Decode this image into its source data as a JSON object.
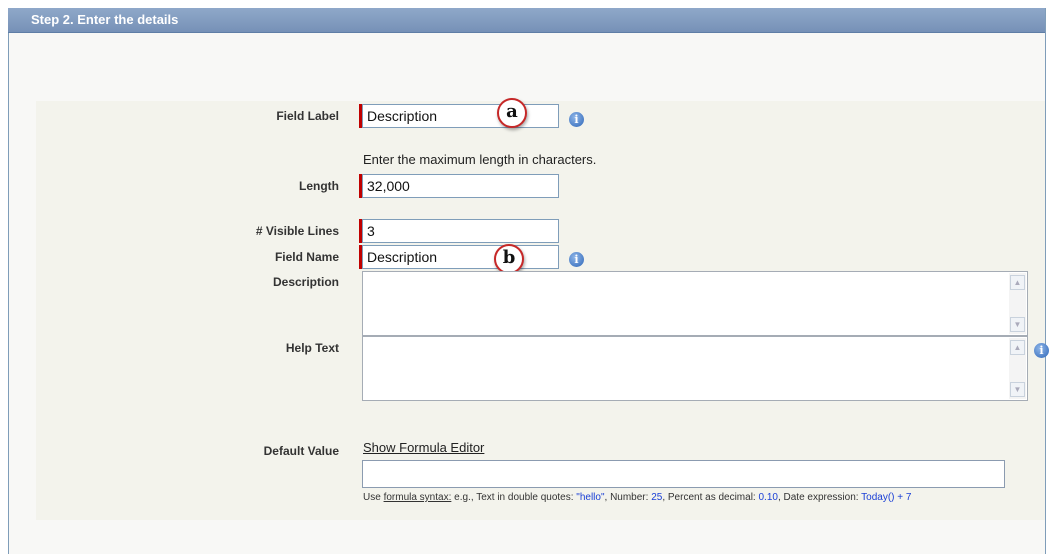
{
  "header": {
    "title": "Step 2. Enter the details"
  },
  "form": {
    "field_label": {
      "label": "Field Label",
      "value": "Description",
      "marker": "a"
    },
    "length_hint": "Enter the maximum length in characters.",
    "length": {
      "label": "Length",
      "value": "32,000"
    },
    "visible_lines": {
      "label": "# Visible Lines",
      "value": "3"
    },
    "field_name": {
      "label": "Field Name",
      "value": "Description",
      "marker": "b"
    },
    "description": {
      "label": "Description",
      "value": ""
    },
    "help_text": {
      "label": "Help Text",
      "value": ""
    },
    "default_value": {
      "label": "Default Value",
      "formula_link": "Show Formula Editor",
      "value": "",
      "hint": {
        "prefix": "Use ",
        "syntax_link": "formula syntax:",
        "part1": " e.g., Text in double quotes: ",
        "text_example": "\"hello\"",
        "part2": ", Number: ",
        "number_example": "25",
        "part3": ", Percent as decimal: ",
        "percent_example": "0.10",
        "part4": ", Date expression: ",
        "date_example": "Today() + 7"
      }
    }
  },
  "icons": {
    "info": "info-icon",
    "scroll_up": "scroll-up-icon",
    "scroll_down": "scroll-down-icon"
  },
  "colors": {
    "header": "#7691b7",
    "required": "#c00000",
    "marker_ring": "#c62828",
    "example_blue": "#1a3fd6"
  }
}
